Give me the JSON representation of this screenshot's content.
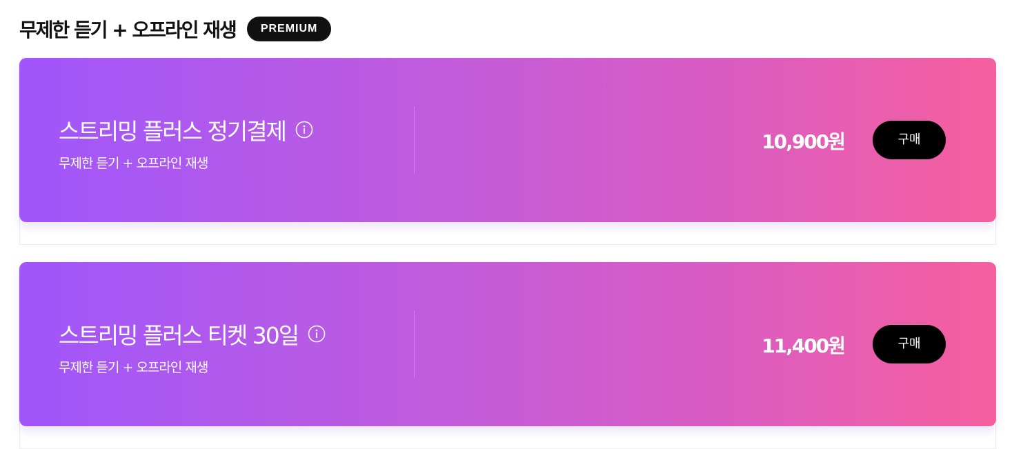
{
  "section": {
    "title": "무제한 듣기 + 오프라인 재생",
    "badge": "PREMIUM"
  },
  "plans": [
    {
      "name": "스트리밍 플러스 정기결제",
      "description": "무제한 듣기 + 오프라인 재생",
      "price": "10,900원",
      "buy_label": "구매",
      "info_icon": "info-circle-icon"
    },
    {
      "name": "스트리밍 플러스 티켓 30일",
      "description": "무제한 듣기 + 오프라인 재생",
      "price": "11,400원",
      "buy_label": "구매",
      "info_icon": "info-circle-icon"
    }
  ],
  "colors": {
    "gradient_start": "#a056fb",
    "gradient_end": "#f65f9e",
    "button_bg": "#000000",
    "badge_bg": "#111111"
  }
}
